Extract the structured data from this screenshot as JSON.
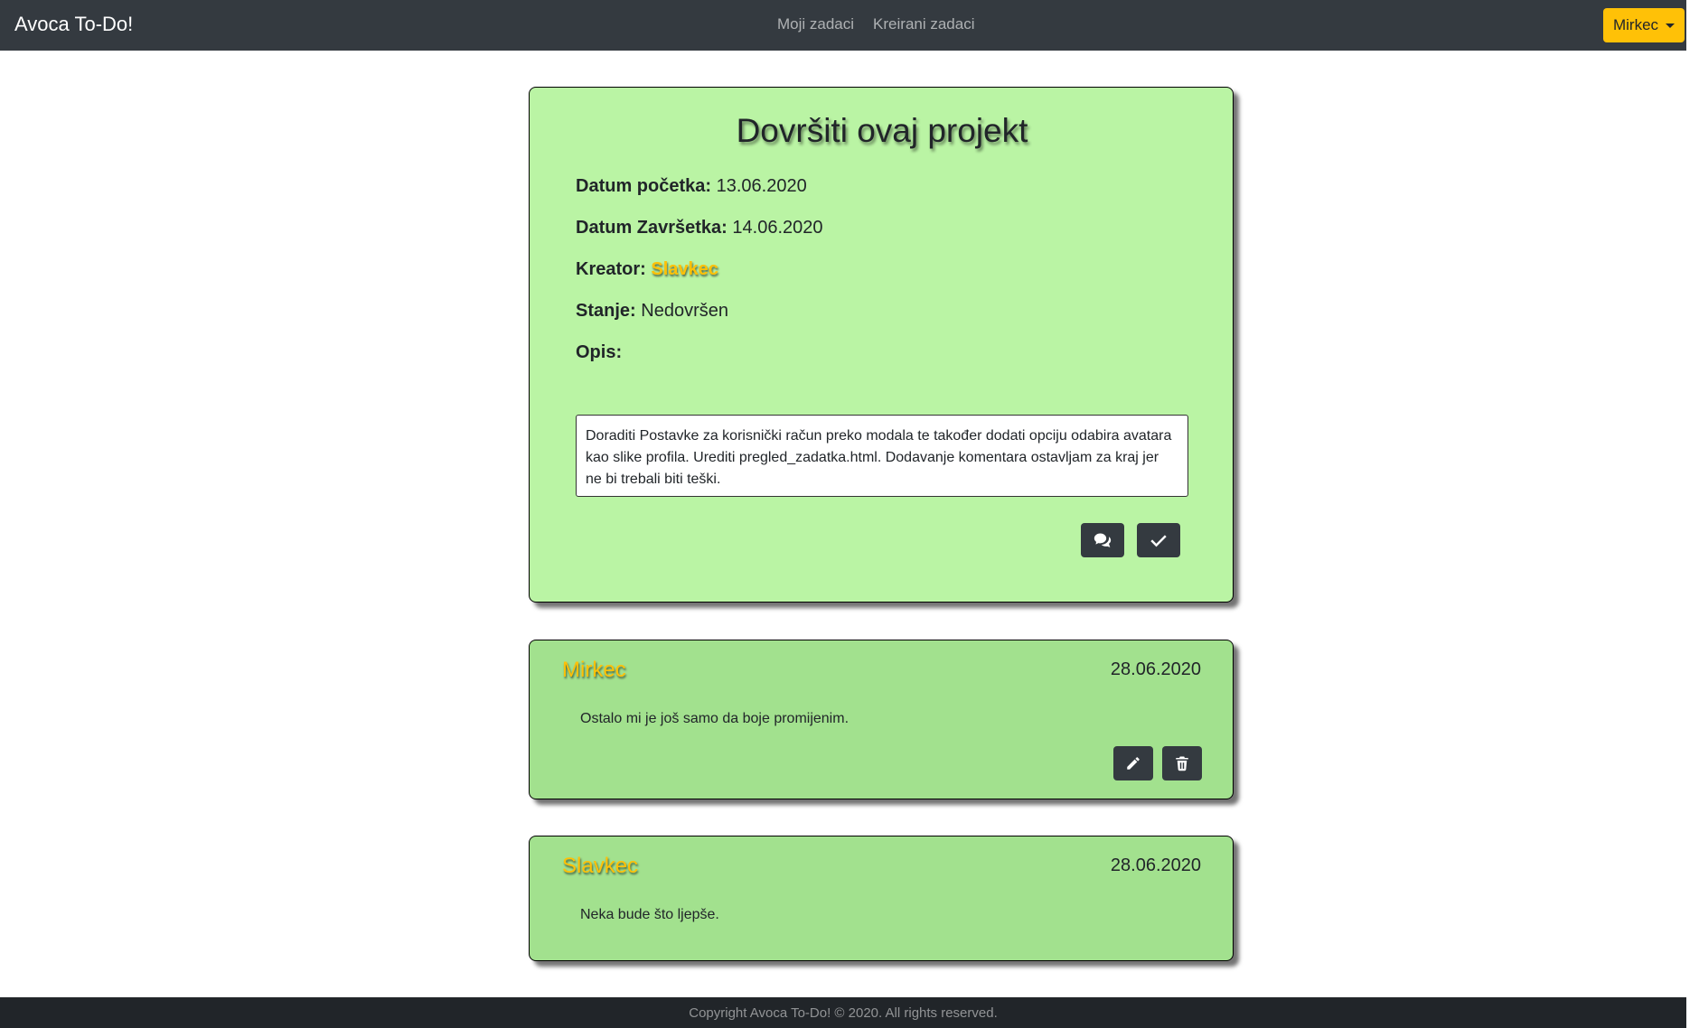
{
  "navbar": {
    "brand": "Avoca To-Do!",
    "links": [
      {
        "label": "Moji zadaci"
      },
      {
        "label": "Kreirani zadaci"
      }
    ],
    "user_menu_label": "Mirkec"
  },
  "task": {
    "title": "Dovršiti ovaj projekt",
    "start_label": "Datum početka:",
    "start_value": "13.06.2020",
    "end_label": "Datum Završetka:",
    "end_value": "14.06.2020",
    "creator_label": "Kreator:",
    "creator_value": "Slavkec",
    "status_label": "Stanje:",
    "status_value": "Nedovršen",
    "description_label": "Opis:",
    "description": "Doraditi Postavke za korisnički račun preko modala te također dodati opciju odabira avatara kao slike profila. Urediti pregled_zadatka.html. Dodavanje komentara ostavljam za kraj jer ne bi trebali biti teški.",
    "actions": [
      {
        "icon": "comments-icon"
      },
      {
        "icon": "check-icon"
      }
    ]
  },
  "comments": [
    {
      "author": "Mirkec",
      "date": "28.06.2020",
      "text": "Ostalo mi je još samo da boje promijenim.",
      "actions": [
        {
          "icon": "pencil-icon"
        },
        {
          "icon": "trash-icon"
        }
      ]
    },
    {
      "author": "Slavkec",
      "date": "28.06.2020",
      "text": "Neka bude što ljepše."
    }
  ],
  "footer": {
    "text": "Copyright Avoca To-Do! © 2020. All rights reserved."
  },
  "colors": {
    "navbar": "#343a40",
    "accent": "#ffc107",
    "task_card": "#baf4a4",
    "comment_card": "#a2e18e",
    "footer": "#212529"
  }
}
